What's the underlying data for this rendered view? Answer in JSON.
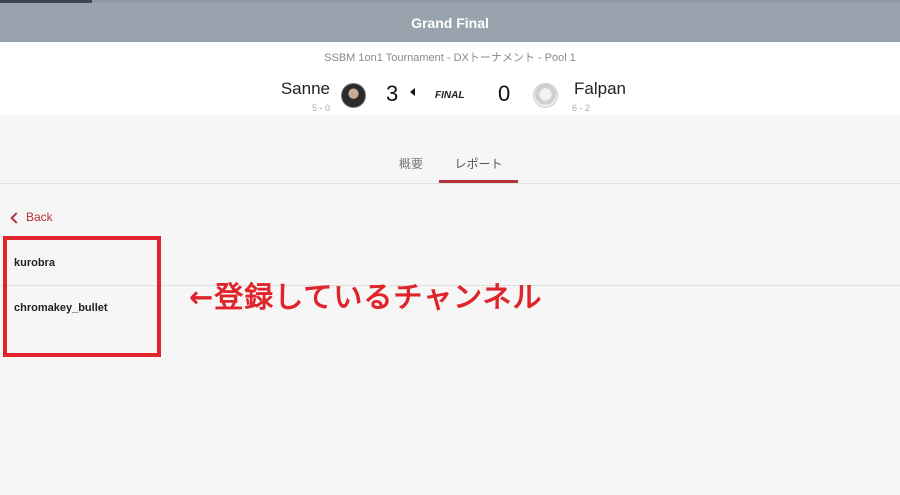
{
  "header": {
    "title": "Grand Final"
  },
  "match": {
    "subtitle": "SSBM 1on1 Tournament - DXトーナメント - Pool 1",
    "status": "FINAL",
    "player1": {
      "name": "Sanne",
      "record": "5 - 0",
      "score": "3",
      "winner": true
    },
    "player2": {
      "name": "Falpan",
      "record": "6 - 2",
      "score": "0",
      "winner": false
    }
  },
  "tabs": [
    {
      "label": "概要",
      "active": false
    },
    {
      "label": "レポート",
      "active": true
    }
  ],
  "back": {
    "label": "Back"
  },
  "channels": [
    {
      "name": "kurobra"
    },
    {
      "name": "chromakey_bullet"
    }
  ],
  "annotation": {
    "text": "←登録しているチャンネル",
    "color": "#e0242c"
  },
  "colors": {
    "accent": "#b3333a",
    "header": "#98a3ad",
    "annotation": "#e0242c"
  }
}
